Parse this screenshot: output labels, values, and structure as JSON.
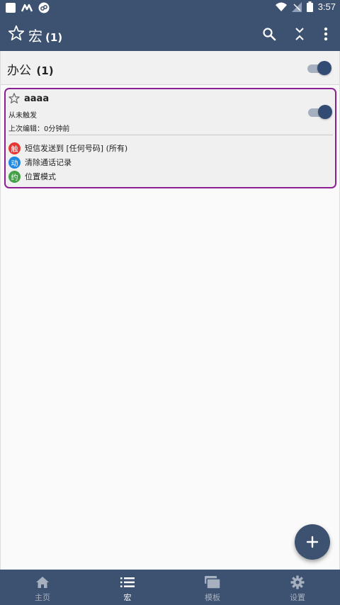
{
  "status_bar": {
    "time": "3:57"
  },
  "toolbar": {
    "title": "宏",
    "count": "(1)"
  },
  "category": {
    "name": "办公",
    "count": "(1)"
  },
  "macro": {
    "name": "aaaa",
    "status": "从未触发",
    "last_edited": "上次编辑：0分钟前",
    "items": [
      {
        "badge": "触",
        "color": "#e53935",
        "text": "短信发送到 [任何号码] (所有)"
      },
      {
        "badge": "动",
        "color": "#1e88e5",
        "text": "清除通话记录"
      },
      {
        "badge": "约",
        "color": "#43a047",
        "text": "位置模式"
      }
    ]
  },
  "bottom_nav": [
    {
      "label": "主页",
      "icon": "home-icon",
      "active": false
    },
    {
      "label": "宏",
      "icon": "list-icon",
      "active": true
    },
    {
      "label": "模板",
      "icon": "templates-icon",
      "active": false
    },
    {
      "label": "设置",
      "icon": "gear-icon",
      "active": false
    }
  ],
  "colors": {
    "primary": "#3d5170",
    "accent_border": "#8d1f94",
    "inactive_nav": "#a7b0bf"
  }
}
